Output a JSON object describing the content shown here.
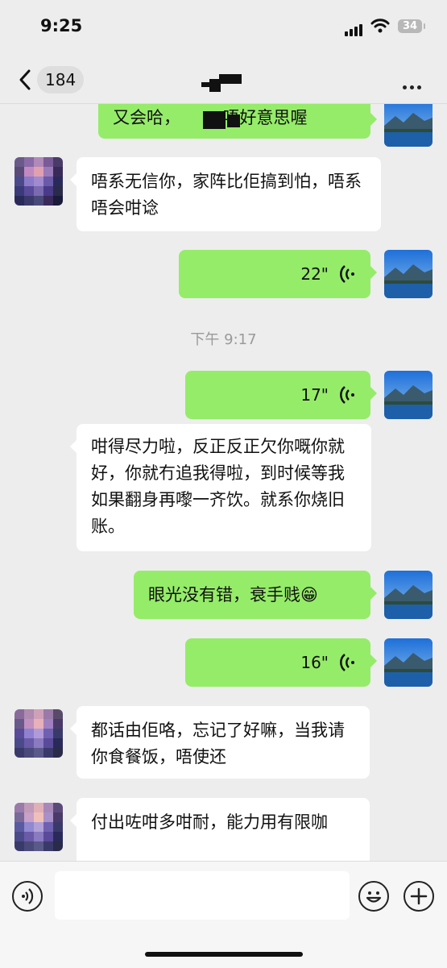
{
  "status_bar": {
    "time": "9:25",
    "battery": "34"
  },
  "nav": {
    "unread_count": "184"
  },
  "messages": [
    {
      "id": "m0",
      "side": "out",
      "type": "text",
      "text": "又会哈，　　　唔好意思喔"
    },
    {
      "id": "m1",
      "side": "in",
      "type": "text",
      "text": "唔系无信你，家阵比佢搞到怕，唔系唔会咁谂"
    },
    {
      "id": "m2",
      "side": "out",
      "type": "voice",
      "duration": "22\""
    },
    {
      "id": "m3",
      "side": "out",
      "type": "voice",
      "duration": "17\""
    },
    {
      "id": "m4",
      "side": "in",
      "type": "text",
      "text": "咁得尽力啦，反正反正欠你嘅你就好，你就冇追我得啦，到时候等我如果翻身再嚟一齐饮。就系你烧旧账。"
    },
    {
      "id": "m5",
      "side": "out",
      "type": "text",
      "text": "眼光没有错，衰手贱"
    },
    {
      "id": "m6",
      "side": "out",
      "type": "voice",
      "duration": "16\""
    },
    {
      "id": "m7",
      "side": "in",
      "type": "text",
      "text": "都话由佢咯，忘记了好嘛，当我请你食餐饭，唔使还"
    },
    {
      "id": "m8",
      "side": "in",
      "type": "text",
      "text": "付出咗咁多咁耐，能力用有限咖"
    }
  ],
  "timestamp": "下午 9:17",
  "emoji_in_m5": "😁",
  "input": {
    "value": "",
    "placeholder": ""
  },
  "colors": {
    "background": "#ededed",
    "outgoing_bubble": "#95ec69",
    "incoming_bubble": "#ffffff",
    "timestamp_text": "#9a9a9a"
  },
  "icons": [
    "back-chevron-icon",
    "more-dots-icon",
    "voice-mode-icon",
    "emoji-icon",
    "plus-icon",
    "voice-wave-icon"
  ]
}
